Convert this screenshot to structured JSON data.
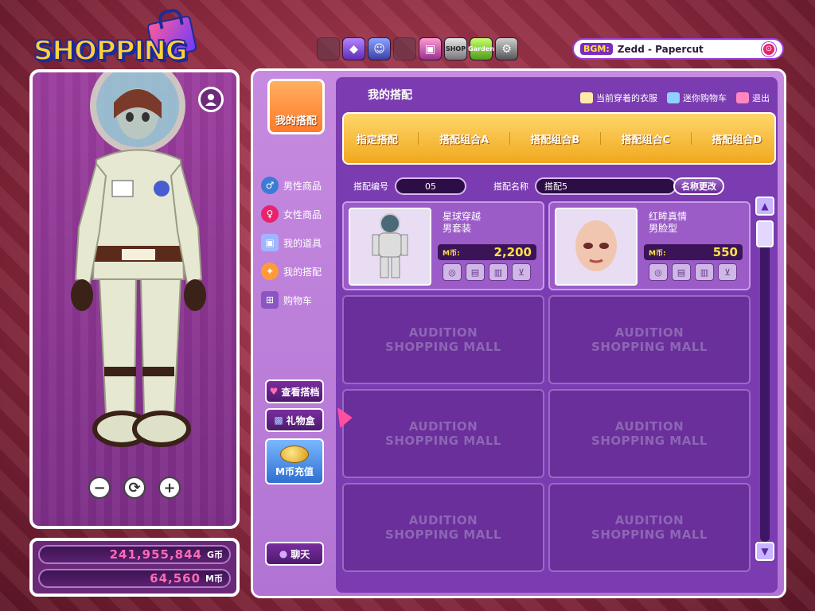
{
  "logo": {
    "text": "SHOPPING MALL"
  },
  "top_icons": {
    "items": [
      {
        "name": "blank-1",
        "label": ""
      },
      {
        "name": "purple-bag",
        "label": "◆"
      },
      {
        "name": "smile",
        "label": "☺"
      },
      {
        "name": "blank-2",
        "label": ""
      },
      {
        "name": "tv",
        "label": "▣"
      },
      {
        "name": "photo",
        "label": "SHOP"
      },
      {
        "name": "garden",
        "label": "Garden"
      },
      {
        "name": "settings",
        "label": "⚙"
      }
    ]
  },
  "bgm": {
    "tag": "BGM:",
    "song": "Zedd - Papercut",
    "button": "⊙"
  },
  "avatar": {
    "controls": [
      "−",
      "⟳",
      "+"
    ]
  },
  "currency": {
    "g_coins": "241,955,844",
    "g_unit": "G币",
    "m_coins": "64,560",
    "m_unit": "M币"
  },
  "shop_nav": {
    "badge": "我的搭配",
    "items": [
      {
        "label": "男性商品"
      },
      {
        "label": "女性商品"
      },
      {
        "label": "我的道具"
      },
      {
        "label": "我的搭配"
      },
      {
        "label": "购物车"
      }
    ],
    "view_archive": "查看搭档",
    "gift_box": "礼物盒",
    "m_recharge": "M币充值",
    "chat": "聊天"
  },
  "content": {
    "title": "我的搭配",
    "current_outfit": "当前穿着的衣服",
    "mini_cart": "迷你购物车",
    "exit": "退出",
    "tabs": [
      "指定搭配",
      "搭配组合A",
      "搭配组合B",
      "搭配组合C",
      "搭配组合D"
    ],
    "outfit_number_label": "搭配编号",
    "outfit_number": "05",
    "outfit_name_label": "搭配名称",
    "outfit_name": "搭配5",
    "rename_button": "名称更改",
    "items": [
      {
        "name_line1": "星球穿越",
        "name_line2": "男套装",
        "price_unit": "M币:",
        "price": "2,200"
      },
      {
        "name_line1": "红眸真情",
        "name_line2": "男脸型",
        "price_unit": "M币:",
        "price": "550"
      }
    ],
    "empty_slot_line1": "AUDITION",
    "empty_slot_line2": "SHOPPING MALL"
  },
  "colors": {
    "accent": "#7b2cbf",
    "tab_bar": "#f0a81e",
    "price": "#ffe14a",
    "currency": "#ff6bb5"
  }
}
